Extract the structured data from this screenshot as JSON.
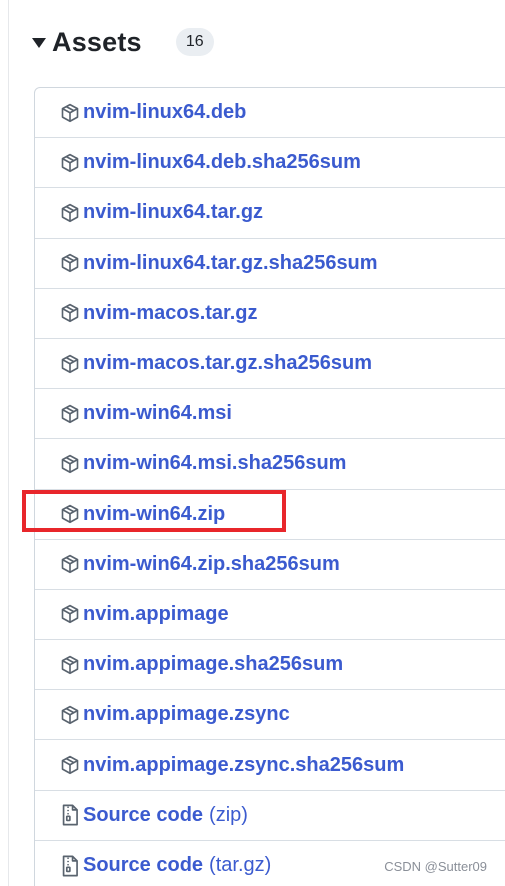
{
  "header": {
    "title": "Assets",
    "count": "16"
  },
  "assets": [
    {
      "name": "nvim-linux64.deb",
      "icon": "package-icon",
      "suffix": ""
    },
    {
      "name": "nvim-linux64.deb.sha256sum",
      "icon": "package-icon",
      "suffix": ""
    },
    {
      "name": "nvim-linux64.tar.gz",
      "icon": "package-icon",
      "suffix": ""
    },
    {
      "name": "nvim-linux64.tar.gz.sha256sum",
      "icon": "package-icon",
      "suffix": ""
    },
    {
      "name": "nvim-macos.tar.gz",
      "icon": "package-icon",
      "suffix": ""
    },
    {
      "name": "nvim-macos.tar.gz.sha256sum",
      "icon": "package-icon",
      "suffix": ""
    },
    {
      "name": "nvim-win64.msi",
      "icon": "package-icon",
      "suffix": ""
    },
    {
      "name": "nvim-win64.msi.sha256sum",
      "icon": "package-icon",
      "suffix": ""
    },
    {
      "name": "nvim-win64.zip",
      "icon": "package-icon",
      "suffix": ""
    },
    {
      "name": "nvim-win64.zip.sha256sum",
      "icon": "package-icon",
      "suffix": ""
    },
    {
      "name": "nvim.appimage",
      "icon": "package-icon",
      "suffix": ""
    },
    {
      "name": "nvim.appimage.sha256sum",
      "icon": "package-icon",
      "suffix": ""
    },
    {
      "name": "nvim.appimage.zsync",
      "icon": "package-icon",
      "suffix": ""
    },
    {
      "name": "nvim.appimage.zsync.sha256sum",
      "icon": "package-icon",
      "suffix": ""
    },
    {
      "name": "Source code",
      "icon": "file-zip-icon",
      "suffix": "(zip)"
    },
    {
      "name": "Source code",
      "icon": "file-zip-icon",
      "suffix": "(tar.gz)"
    }
  ],
  "highlighted_asset": "nvim-win64.zip",
  "watermark": "CSDN @Sutter09",
  "colors": {
    "link": "#3b5bcf",
    "highlight": "#e8262b",
    "border": "#d0d7de"
  }
}
